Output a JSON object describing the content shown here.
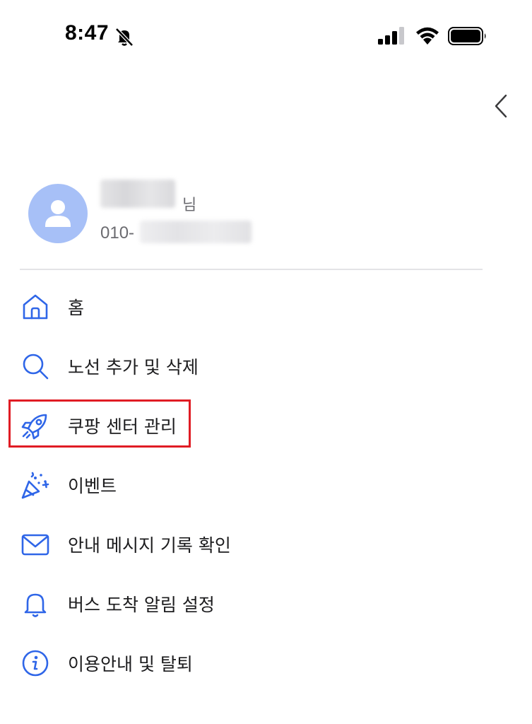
{
  "status_bar": {
    "time": "8:47",
    "icons": [
      "bell-slash-icon",
      "cellular-signal-icon",
      "wifi-icon",
      "battery-icon"
    ]
  },
  "header": {
    "back_icon": "chevron-left-icon"
  },
  "profile": {
    "name_hidden": "●●●",
    "name_suffix": "님",
    "phone_prefix": "010-",
    "phone_hidden": "●●●● ●●●●"
  },
  "menu": {
    "items": [
      {
        "label": "홈",
        "icon": "home-icon"
      },
      {
        "label": "노선 추가 및 삭제",
        "icon": "search-icon"
      },
      {
        "label": "쿠팡 센터 관리",
        "icon": "rocket-icon"
      },
      {
        "label": "이벤트",
        "icon": "party-popper-icon"
      },
      {
        "label": "안내 메시지 기록 확인",
        "icon": "mail-icon"
      },
      {
        "label": "버스 도착 알림 설정",
        "icon": "bell-icon"
      },
      {
        "label": "이용안내 및 탈퇴",
        "icon": "info-icon"
      }
    ]
  },
  "colors": {
    "accent": "#2f66e8",
    "avatar_bg": "#a7c0f7",
    "highlight_border": "#e01c24"
  }
}
